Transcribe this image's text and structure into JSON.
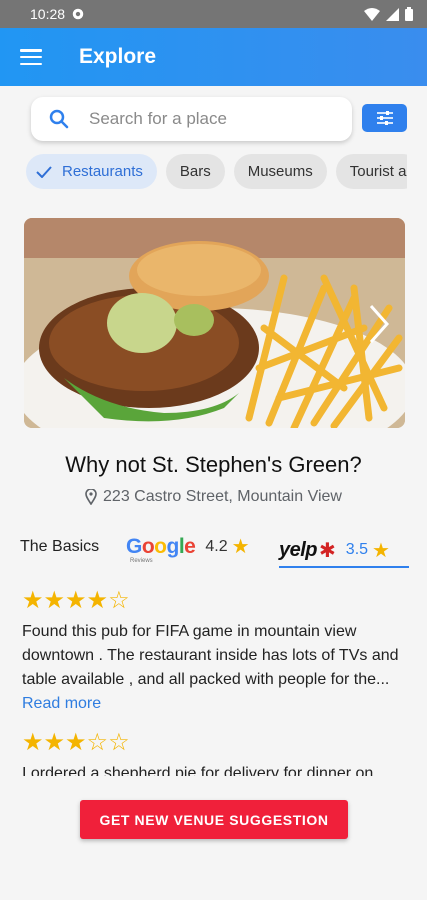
{
  "status_bar": {
    "time": "10:28"
  },
  "app_bar": {
    "title": "Explore",
    "menu_icon": "menu-icon"
  },
  "search": {
    "placeholder": "Search for a place",
    "icon": "search-icon"
  },
  "filter_button": {
    "icon": "tune-icon"
  },
  "chips": [
    {
      "label": "Restaurants",
      "selected": true
    },
    {
      "label": "Bars",
      "selected": false
    },
    {
      "label": "Museums",
      "selected": false
    },
    {
      "label": "Tourist a",
      "selected": false
    }
  ],
  "venue": {
    "name": "Why not St. Stephen's Green?",
    "address": "223 Castro Street, Mountain View"
  },
  "ratings": {
    "basics_label": "The Basics",
    "google": {
      "logo": "Google",
      "sub": "Reviews",
      "score": "4.2"
    },
    "yelp": {
      "logo": "yelp",
      "score": "3.5"
    }
  },
  "reviews": [
    {
      "stars": 4,
      "text": "Found this pub for FIFA game in mountain view downtown . The restaurant inside has lots of TVs and table available , and all packed with people for the...",
      "read_more": "Read more"
    },
    {
      "stars": 3,
      "text": "I ordered a shepherd pie for delivery for dinner on"
    }
  ],
  "cta": {
    "label": "GET NEW VENUE SUGGESTION"
  },
  "colors": {
    "accent": "#2f80ed",
    "cta": "#f0203a",
    "star": "#f4b400"
  }
}
